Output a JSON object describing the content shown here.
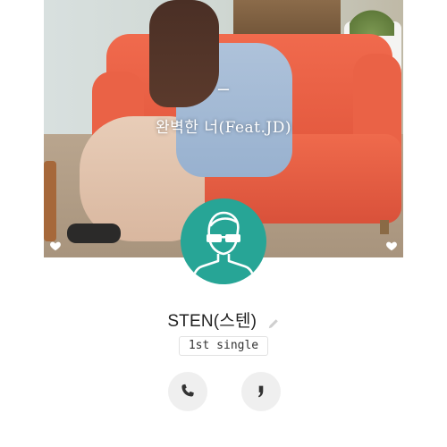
{
  "cover": {
    "song_dash": "–",
    "song_title": "완벽한 너(Feat.JD)"
  },
  "icons": {
    "left_heart": "heart-icon",
    "right_heart": "heart-icon",
    "avatar": "default-profile-avatar-with-sunglasses",
    "edit": "pencil-icon",
    "call": "phone-icon",
    "message": "quote-comma-icon"
  },
  "profile": {
    "name": "STEN(스텐)",
    "status": "1st single"
  },
  "colors": {
    "avatar_bg": "#27a596",
    "button_bg": "#efefef"
  }
}
